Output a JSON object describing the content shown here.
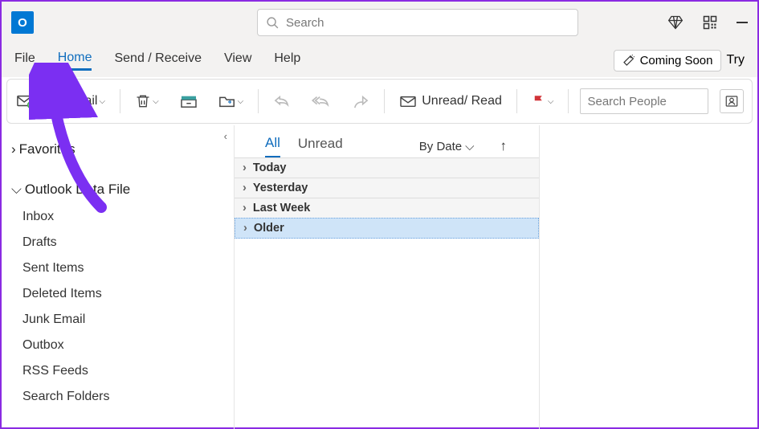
{
  "titlebar": {
    "search_placeholder": "Search"
  },
  "tabs": {
    "file": "File",
    "home": "Home",
    "send_receive": "Send / Receive",
    "view": "View",
    "help": "Help",
    "coming_soon": "Coming Soon",
    "try": "Try"
  },
  "ribbon": {
    "new_email": "New Email",
    "unread_read": "Unread/ Read",
    "search_people_placeholder": "Search People"
  },
  "folder_pane": {
    "favorites": "Favorites",
    "data_file": "Outlook Data File",
    "folders": [
      "Inbox",
      "Drafts",
      "Sent Items",
      "Deleted Items",
      "Junk Email",
      "Outbox",
      "RSS Feeds",
      "Search Folders"
    ]
  },
  "msglist": {
    "tab_all": "All",
    "tab_unread": "Unread",
    "bydate": "By Date",
    "groups": [
      "Today",
      "Yesterday",
      "Last Week",
      "Older"
    ]
  }
}
